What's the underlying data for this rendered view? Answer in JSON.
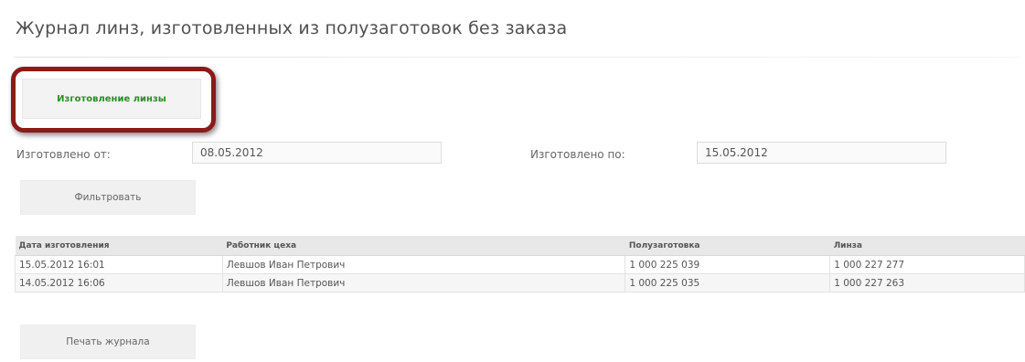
{
  "page": {
    "title": "Журнал линз, изготовленных из полузаготовок без заказа"
  },
  "actions": {
    "make_lens_label": "Изготовление линзы",
    "filter_label": "Фильтровать",
    "print_label": "Печать журнала"
  },
  "filters": {
    "from_label": "Изготовлено от:",
    "from_value": "08.05.2012",
    "to_label": "Изготовлено по:",
    "to_value": "15.05.2012"
  },
  "table": {
    "columns": [
      "Дата изготовления",
      "Работник цеха",
      "Полузаготовка",
      "Линза"
    ],
    "rows": [
      [
        "15.05.2012 16:01",
        "Левшов Иван Петрович",
        "1 000 225 039",
        "1 000 227 277"
      ],
      [
        "14.05.2012 16:06",
        "Левшов Иван Петрович",
        "1 000 225 035",
        "1 000 227 263"
      ]
    ]
  },
  "colors": {
    "highlight_border": "#8b1a1a",
    "primary_action_text": "#2d8c28"
  }
}
